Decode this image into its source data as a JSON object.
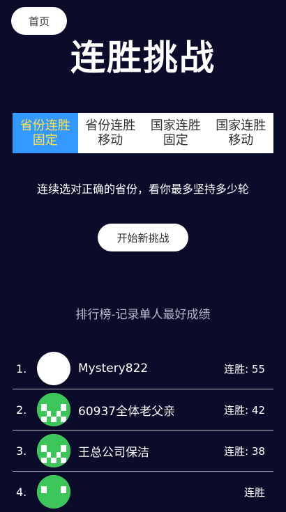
{
  "nav": {
    "home_label": "首页"
  },
  "page": {
    "title": "连胜挑战"
  },
  "tabs": [
    {
      "label": "省份连胜\n固定",
      "active": true
    },
    {
      "label": "省份连胜\n移动",
      "active": false
    },
    {
      "label": "国家连胜\n固定",
      "active": false
    },
    {
      "label": "国家连胜\n移动",
      "active": false
    }
  ],
  "description": "连续选对正确的省份，看你最多坚持多少轮",
  "start_button": "开始新挑战",
  "leaderboard": {
    "title": "排行榜-记录单人最好成绩",
    "rows": [
      {
        "rank": "1.",
        "name": "Mystery822",
        "score": "连胜: 55",
        "avatar": "blank"
      },
      {
        "rank": "2.",
        "name": "60937全体老父亲",
        "score": "连胜: 42",
        "avatar": "identicon-green"
      },
      {
        "rank": "3.",
        "name": "王总公司保洁",
        "score": "连胜: 38",
        "avatar": "identicon-green"
      },
      {
        "rank": "4.",
        "name": "",
        "score": "连胜",
        "avatar": "identicon-green"
      }
    ]
  },
  "colors": {
    "background": "#0b0b2a",
    "tab_active_bg": "#3399ff",
    "tab_active_text": "#ffe14d",
    "avatar_green": "#3cc65a"
  }
}
